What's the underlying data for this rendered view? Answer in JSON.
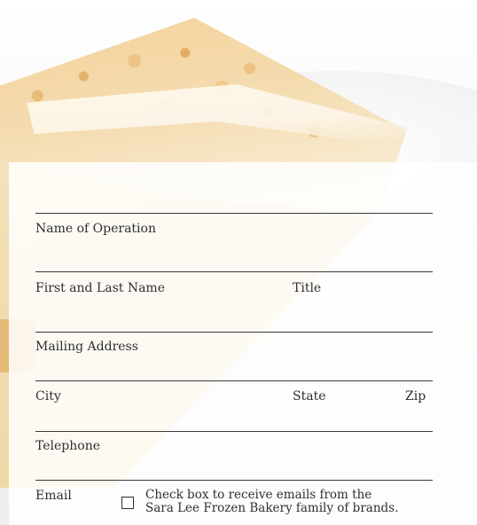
{
  "form": {
    "name_of_operation": "Name of Operation",
    "first_last_name": "First and Last Name",
    "title": "Title",
    "mailing_address": "Mailing Address",
    "city": "City",
    "state": "State",
    "zip": "Zip",
    "telephone": "Telephone",
    "email": "Email",
    "consent_line1": "Check box to receive emails from the",
    "consent_line2": "Sara Lee Frozen Bakery family of brands."
  },
  "colors": {
    "text": "#2f2f2f",
    "rule": "#3a3a3a",
    "panel": "#ffffff",
    "cake": "#f2ddb1"
  }
}
